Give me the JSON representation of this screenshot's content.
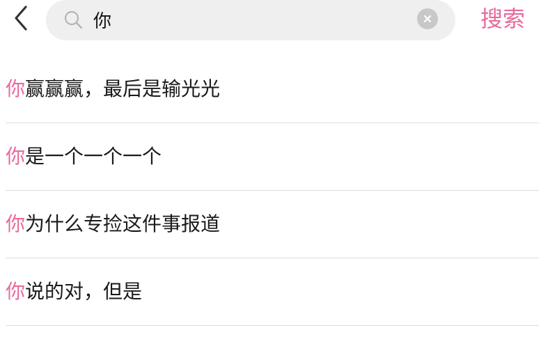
{
  "search": {
    "value": "你",
    "button_label": "搜索"
  },
  "results": [
    {
      "match": "你",
      "rest": "赢赢赢，最后是输光光"
    },
    {
      "match": "你",
      "rest": "是一个一个一个"
    },
    {
      "match": "你",
      "rest": "为什么专捡这件事报道"
    },
    {
      "match": "你",
      "rest": "说的对，但是"
    }
  ],
  "colors": {
    "accent": "#e8699e",
    "search_bg": "#efefef",
    "divider": "#dcdcdc"
  },
  "icons": {
    "back": "chevron-left-icon",
    "search": "search-icon",
    "clear": "clear-icon"
  }
}
